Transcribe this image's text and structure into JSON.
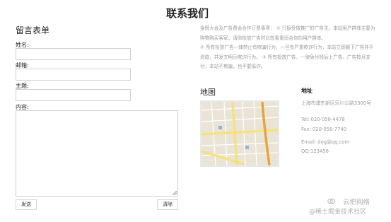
{
  "page": {
    "title": "联系我们"
  },
  "form": {
    "title": "留言表单",
    "name_label": "姓名:",
    "email_label": "邮箱:",
    "subject_label": "主题:",
    "content_label": "内容:",
    "send_label": "发送",
    "clear_label": "清除"
  },
  "notice": {
    "paragraph1": "金牌大会及广告费会合作订票事项： ① 只接受做推广的广告主。本站用户群体主要为购物购买客家，请你投放广告时比较看重适合你的用户群体。",
    "paragraph2": "② 所有投放广告一律禁止有欺骗行为，一旦有严重欺诈行为，本站立即删下广告并不退款，并发文明示欺诈行为。 ③ 所有投放广告，一律免付钱后上广告，广告按月支付，本站不欺骗，也不要搞诈。"
  },
  "map": {
    "title": "地图"
  },
  "contact": {
    "address_title": "地址",
    "address": "上海市浦东新区乐川公路3300号",
    "tel": "Tel: 020-058-4478",
    "fax": "Fax: 020-058-7740",
    "email": "Email: dog@qq.com",
    "qq": "QQ:123456"
  },
  "watermark": {
    "line1": "云把网络",
    "line2": "@稀土掘金技术社区"
  },
  "colors": {
    "muted_text": "#9a9a9a",
    "field_border": "#cfcfcf",
    "map_road_yellow": "#f6e27a",
    "map_road_orange": "#e8a33a"
  }
}
